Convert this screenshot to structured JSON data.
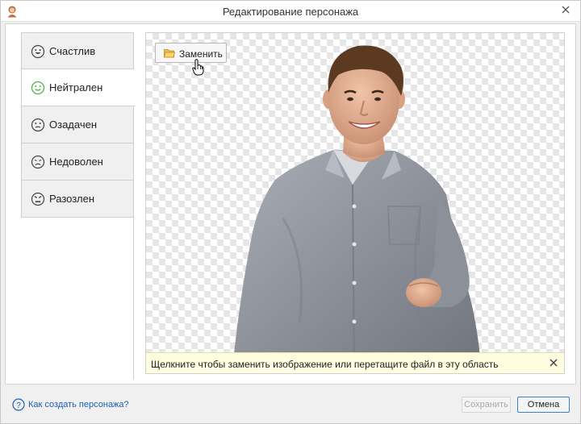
{
  "window": {
    "title": "Редактирование персонажа",
    "app_icon": "character-avatar-icon",
    "close_icon": "close-icon"
  },
  "tabs": [
    {
      "label": "Счастлив",
      "icon": "happy-face-icon",
      "active": false
    },
    {
      "label": "Нейтрален",
      "icon": "neutral-smile-face-icon",
      "active": true
    },
    {
      "label": "Озадачен",
      "icon": "puzzled-face-icon",
      "active": false
    },
    {
      "label": "Недоволен",
      "icon": "sad-face-icon",
      "active": false
    },
    {
      "label": "Разозлен",
      "icon": "angry-face-icon",
      "active": false
    }
  ],
  "canvas": {
    "replace_button": {
      "label": "Заменить",
      "icon": "folder-open-icon"
    },
    "hint": {
      "text": "Щелкните чтобы заменить изображение или перетащите файл в эту область",
      "close_icon": "close-icon"
    }
  },
  "footer": {
    "help_link": "Как создать персонажа?",
    "help_icon": "help-icon",
    "save_label": "Сохранить",
    "cancel_label": "Отмена"
  },
  "colors": {
    "active_icon": "#4bb543",
    "link": "#1a5fb4",
    "hint_background": "#fffde0",
    "default_button_border": "#3c7fd6"
  }
}
